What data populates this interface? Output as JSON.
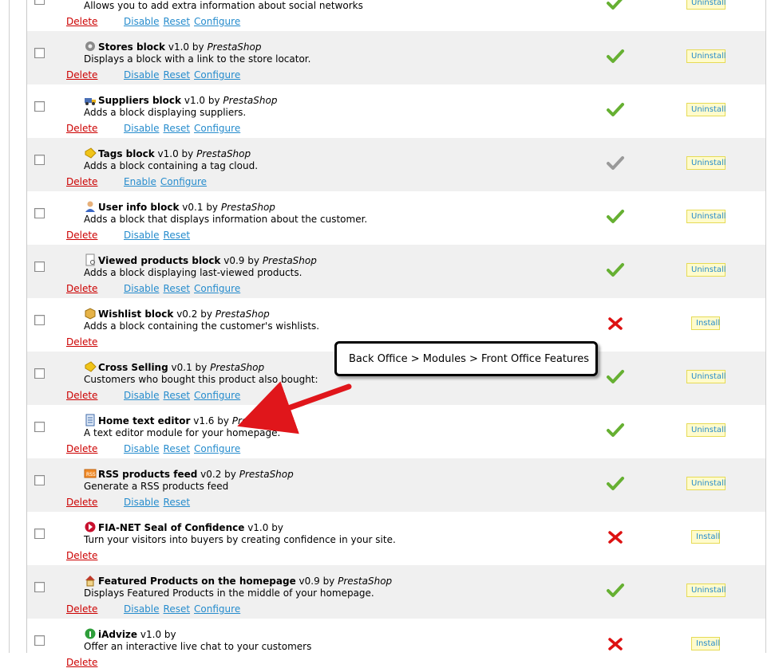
{
  "actions": {
    "delete": "Delete",
    "disable": "Disable",
    "enable": "Enable",
    "reset": "Reset",
    "configure": "Configure",
    "install": "Install",
    "uninstall": "Uninstall"
  },
  "callout": {
    "text": "Back Office > Modules > Front Office Features"
  },
  "modules": [
    {
      "name": "",
      "version": "",
      "author": "",
      "description": "Allows you to add extra information about social networks",
      "status": "enabled",
      "icon": "social-icon",
      "links": [
        "disable",
        "reset",
        "configure"
      ],
      "button": "uninstall"
    },
    {
      "name": "Stores block",
      "version": "v1.0",
      "author": "PrestaShop",
      "description": "Displays a block with a link to the store locator.",
      "status": "enabled",
      "icon": "gear-icon",
      "links": [
        "disable",
        "reset",
        "configure"
      ],
      "button": "uninstall"
    },
    {
      "name": "Suppliers block",
      "version": "v1.0",
      "author": "PrestaShop",
      "description": "Adds a block displaying suppliers.",
      "status": "enabled",
      "icon": "truck-icon",
      "links": [
        "disable",
        "reset",
        "configure"
      ],
      "button": "uninstall"
    },
    {
      "name": "Tags block",
      "version": "v1.0",
      "author": "PrestaShop",
      "description": "Adds a block containing a tag cloud.",
      "status": "disabled",
      "icon": "tag-icon",
      "links": [
        "enable",
        "configure"
      ],
      "button": "uninstall"
    },
    {
      "name": "User info block",
      "version": "v0.1",
      "author": "PrestaShop",
      "description": "Adds a block that displays information about the customer.",
      "status": "enabled",
      "icon": "user-icon",
      "links": [
        "disable",
        "reset"
      ],
      "button": "uninstall"
    },
    {
      "name": "Viewed products block",
      "version": "v0.9",
      "author": "PrestaShop",
      "description": "Adds a block displaying last-viewed products.",
      "status": "enabled",
      "icon": "page-icon",
      "links": [
        "disable",
        "reset",
        "configure"
      ],
      "button": "uninstall"
    },
    {
      "name": "Wishlist block",
      "version": "v0.2",
      "author": "PrestaShop",
      "description": "Adds a block containing the customer's wishlists.",
      "status": "not-installed",
      "icon": "box-icon",
      "links": [],
      "button": "install"
    },
    {
      "name": "Cross Selling",
      "version": "v0.1",
      "author": "PrestaShop",
      "description": "Customers who bought this product also bought:",
      "status": "enabled",
      "icon": "tag-icon",
      "links": [
        "disable",
        "reset",
        "configure"
      ],
      "button": "uninstall"
    },
    {
      "name": "Home text editor",
      "version": "v1.6",
      "author": "PrestaShop",
      "description": "A text editor module for your homepage.",
      "status": "enabled",
      "icon": "document-icon",
      "links": [
        "disable",
        "reset",
        "configure"
      ],
      "button": "uninstall"
    },
    {
      "name": "RSS products feed",
      "version": "v0.2",
      "author": "PrestaShop",
      "description": "Generate a RSS products feed",
      "status": "enabled",
      "icon": "rss-icon",
      "links": [
        "disable",
        "reset"
      ],
      "button": "uninstall"
    },
    {
      "name": "FIA-NET Seal of Confidence",
      "version": "v1.0",
      "author": "",
      "description": "Turn your visitors into buyers by creating confidence in your site.",
      "status": "not-installed",
      "icon": "fianet-icon",
      "links": [],
      "button": "install"
    },
    {
      "name": "Featured Products on the homepage",
      "version": "v0.9",
      "author": "PrestaShop",
      "description": "Displays Featured Products in the middle of your homepage.",
      "status": "enabled",
      "icon": "home-icon",
      "links": [
        "disable",
        "reset",
        "configure"
      ],
      "button": "uninstall"
    },
    {
      "name": "iAdvize",
      "version": "v1.0",
      "author": "",
      "description": "Offer an interactive live chat to your customers",
      "status": "not-installed",
      "icon": "iadvize-icon",
      "links": [],
      "button": "install"
    }
  ],
  "colors": {
    "delete": "#cc0000",
    "link": "#268ccd",
    "check_enabled": "#66b032",
    "check_disabled": "#9a9a9a",
    "cross": "#dd1111",
    "button_bg": "#fffbcc"
  }
}
